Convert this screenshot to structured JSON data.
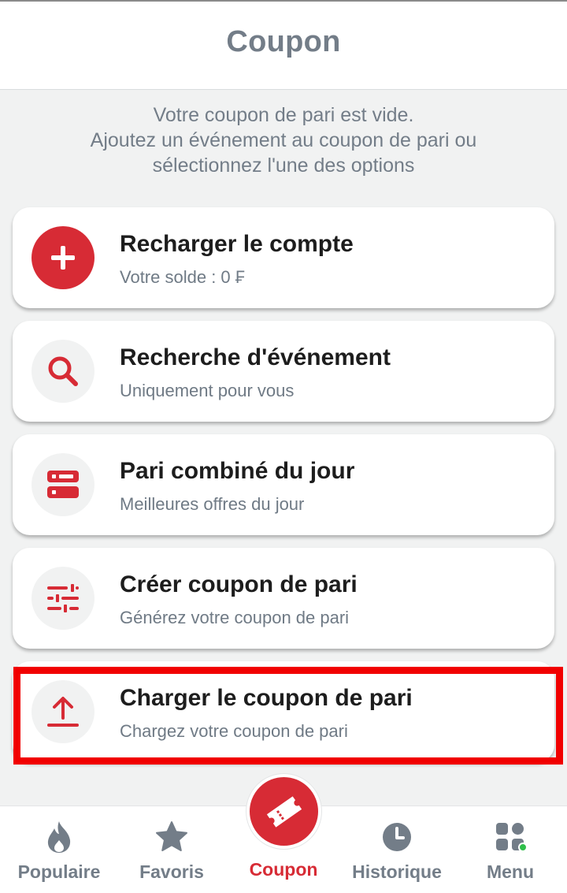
{
  "header": {
    "title": "Coupon"
  },
  "empty_message": {
    "line1": "Votre coupon de pari est vide.",
    "line2": "Ajoutez un événement au coupon de pari ou",
    "line3": "sélectionnez l'une des options"
  },
  "cards": [
    {
      "title": "Recharger le compte",
      "subtitle": "Votre solde : 0 ₣",
      "icon": "plus-icon"
    },
    {
      "title": "Recherche d'événement",
      "subtitle": "Uniquement pour vous",
      "icon": "search-icon"
    },
    {
      "title": "Pari combiné du jour",
      "subtitle": "Meilleures offres du jour",
      "icon": "list-toggle-icon"
    },
    {
      "title": "Créer coupon de pari",
      "subtitle": "Générez votre coupon de pari",
      "icon": "sliders-icon"
    },
    {
      "title": "Charger le coupon de pari",
      "subtitle": "Chargez votre coupon de pari",
      "icon": "upload-icon"
    }
  ],
  "nav": [
    {
      "label": "Populaire",
      "icon": "flame-icon"
    },
    {
      "label": "Favoris",
      "icon": "star-icon"
    },
    {
      "label": "Coupon",
      "icon": "ticket-icon",
      "active": true
    },
    {
      "label": "Historique",
      "icon": "clock-icon"
    },
    {
      "label": "Menu",
      "icon": "grid-icon"
    }
  ],
  "colors": {
    "accent": "#d72b35",
    "muted": "#737d88",
    "highlight": "#f10000",
    "online": "#2fbf4a"
  }
}
